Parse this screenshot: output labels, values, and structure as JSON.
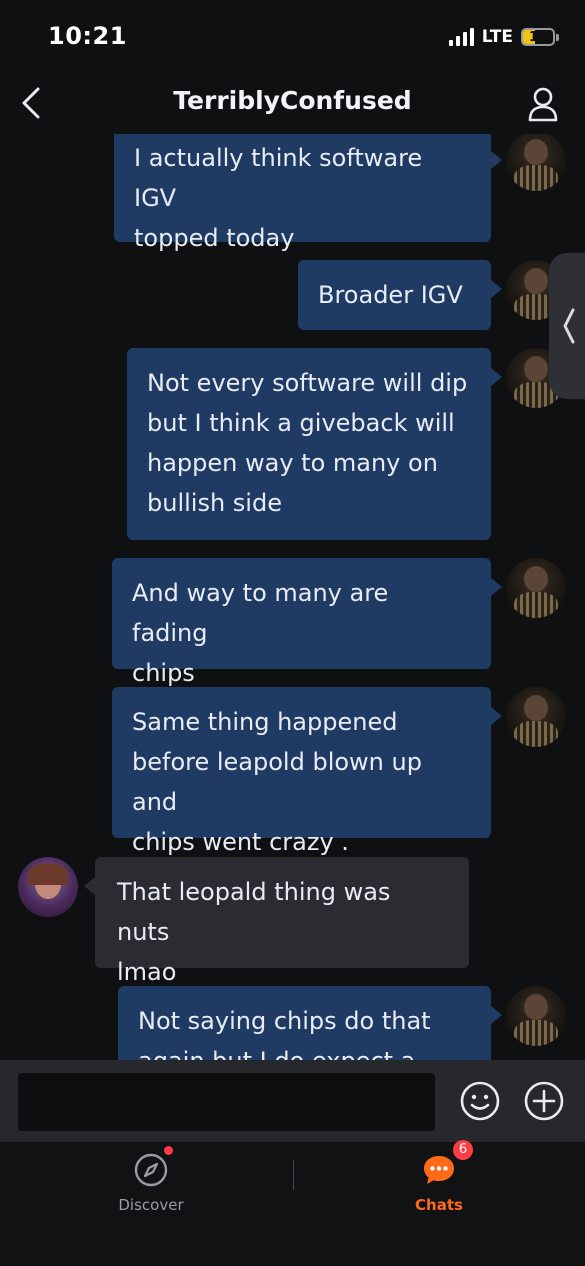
{
  "status_bar": {
    "time": "10:21",
    "network": "LTE",
    "battery_level": "12",
    "battery_color": "#f2c31a"
  },
  "header": {
    "title": "TerriblyConfused",
    "back_icon": "chevron-left-icon",
    "profile_icon": "user-icon"
  },
  "messages": [
    {
      "from": "me",
      "text": "I actually think software IGV topped today",
      "lines": [
        "I actually think software IGV",
        "topped today"
      ]
    },
    {
      "from": "me",
      "text": "Broader IGV",
      "lines": [
        "Broader IGV"
      ]
    },
    {
      "from": "me",
      "text": "Not every software will dip but I think a giveback will happen way to many on bullish side",
      "lines": [
        "Not every software will dip",
        "but I think a giveback will",
        "happen way to many on",
        "bullish side"
      ]
    },
    {
      "from": "me",
      "text": "And way to many are fading chips",
      "lines": [
        "And way to many are fading",
        "chips"
      ]
    },
    {
      "from": "me",
      "text": "Same thing happened before leapold blown up and chips went crazy .",
      "lines": [
        "Same thing happened",
        "before leapold blown up and",
        "chips went crazy ."
      ]
    },
    {
      "from": "them",
      "text": "That leopald thing was nuts lmao",
      "lines": [
        "That leopald thing was nuts",
        "lmao"
      ]
    },
    {
      "from": "me",
      "text": "Not saying chips do that again but I do expect a rally",
      "lines": [
        "Not saying chips do that",
        "again but I do expect a rally"
      ]
    }
  ],
  "composer": {
    "value": "",
    "emoji_icon": "smiley-icon",
    "add_icon": "plus-circle-icon"
  },
  "bottom_nav": {
    "discover_label": "Discover",
    "discover_icon": "compass-icon",
    "chats_label": "Chats",
    "chats_icon": "chat-bubble-icon",
    "chats_badge": "6",
    "accent_color": "#ff6a1a",
    "badge_color": "#ff3b46"
  },
  "colors": {
    "outgoing_bubble": "#1f3a63",
    "incoming_bubble": "#2a2c31",
    "background": "#0f1012"
  }
}
